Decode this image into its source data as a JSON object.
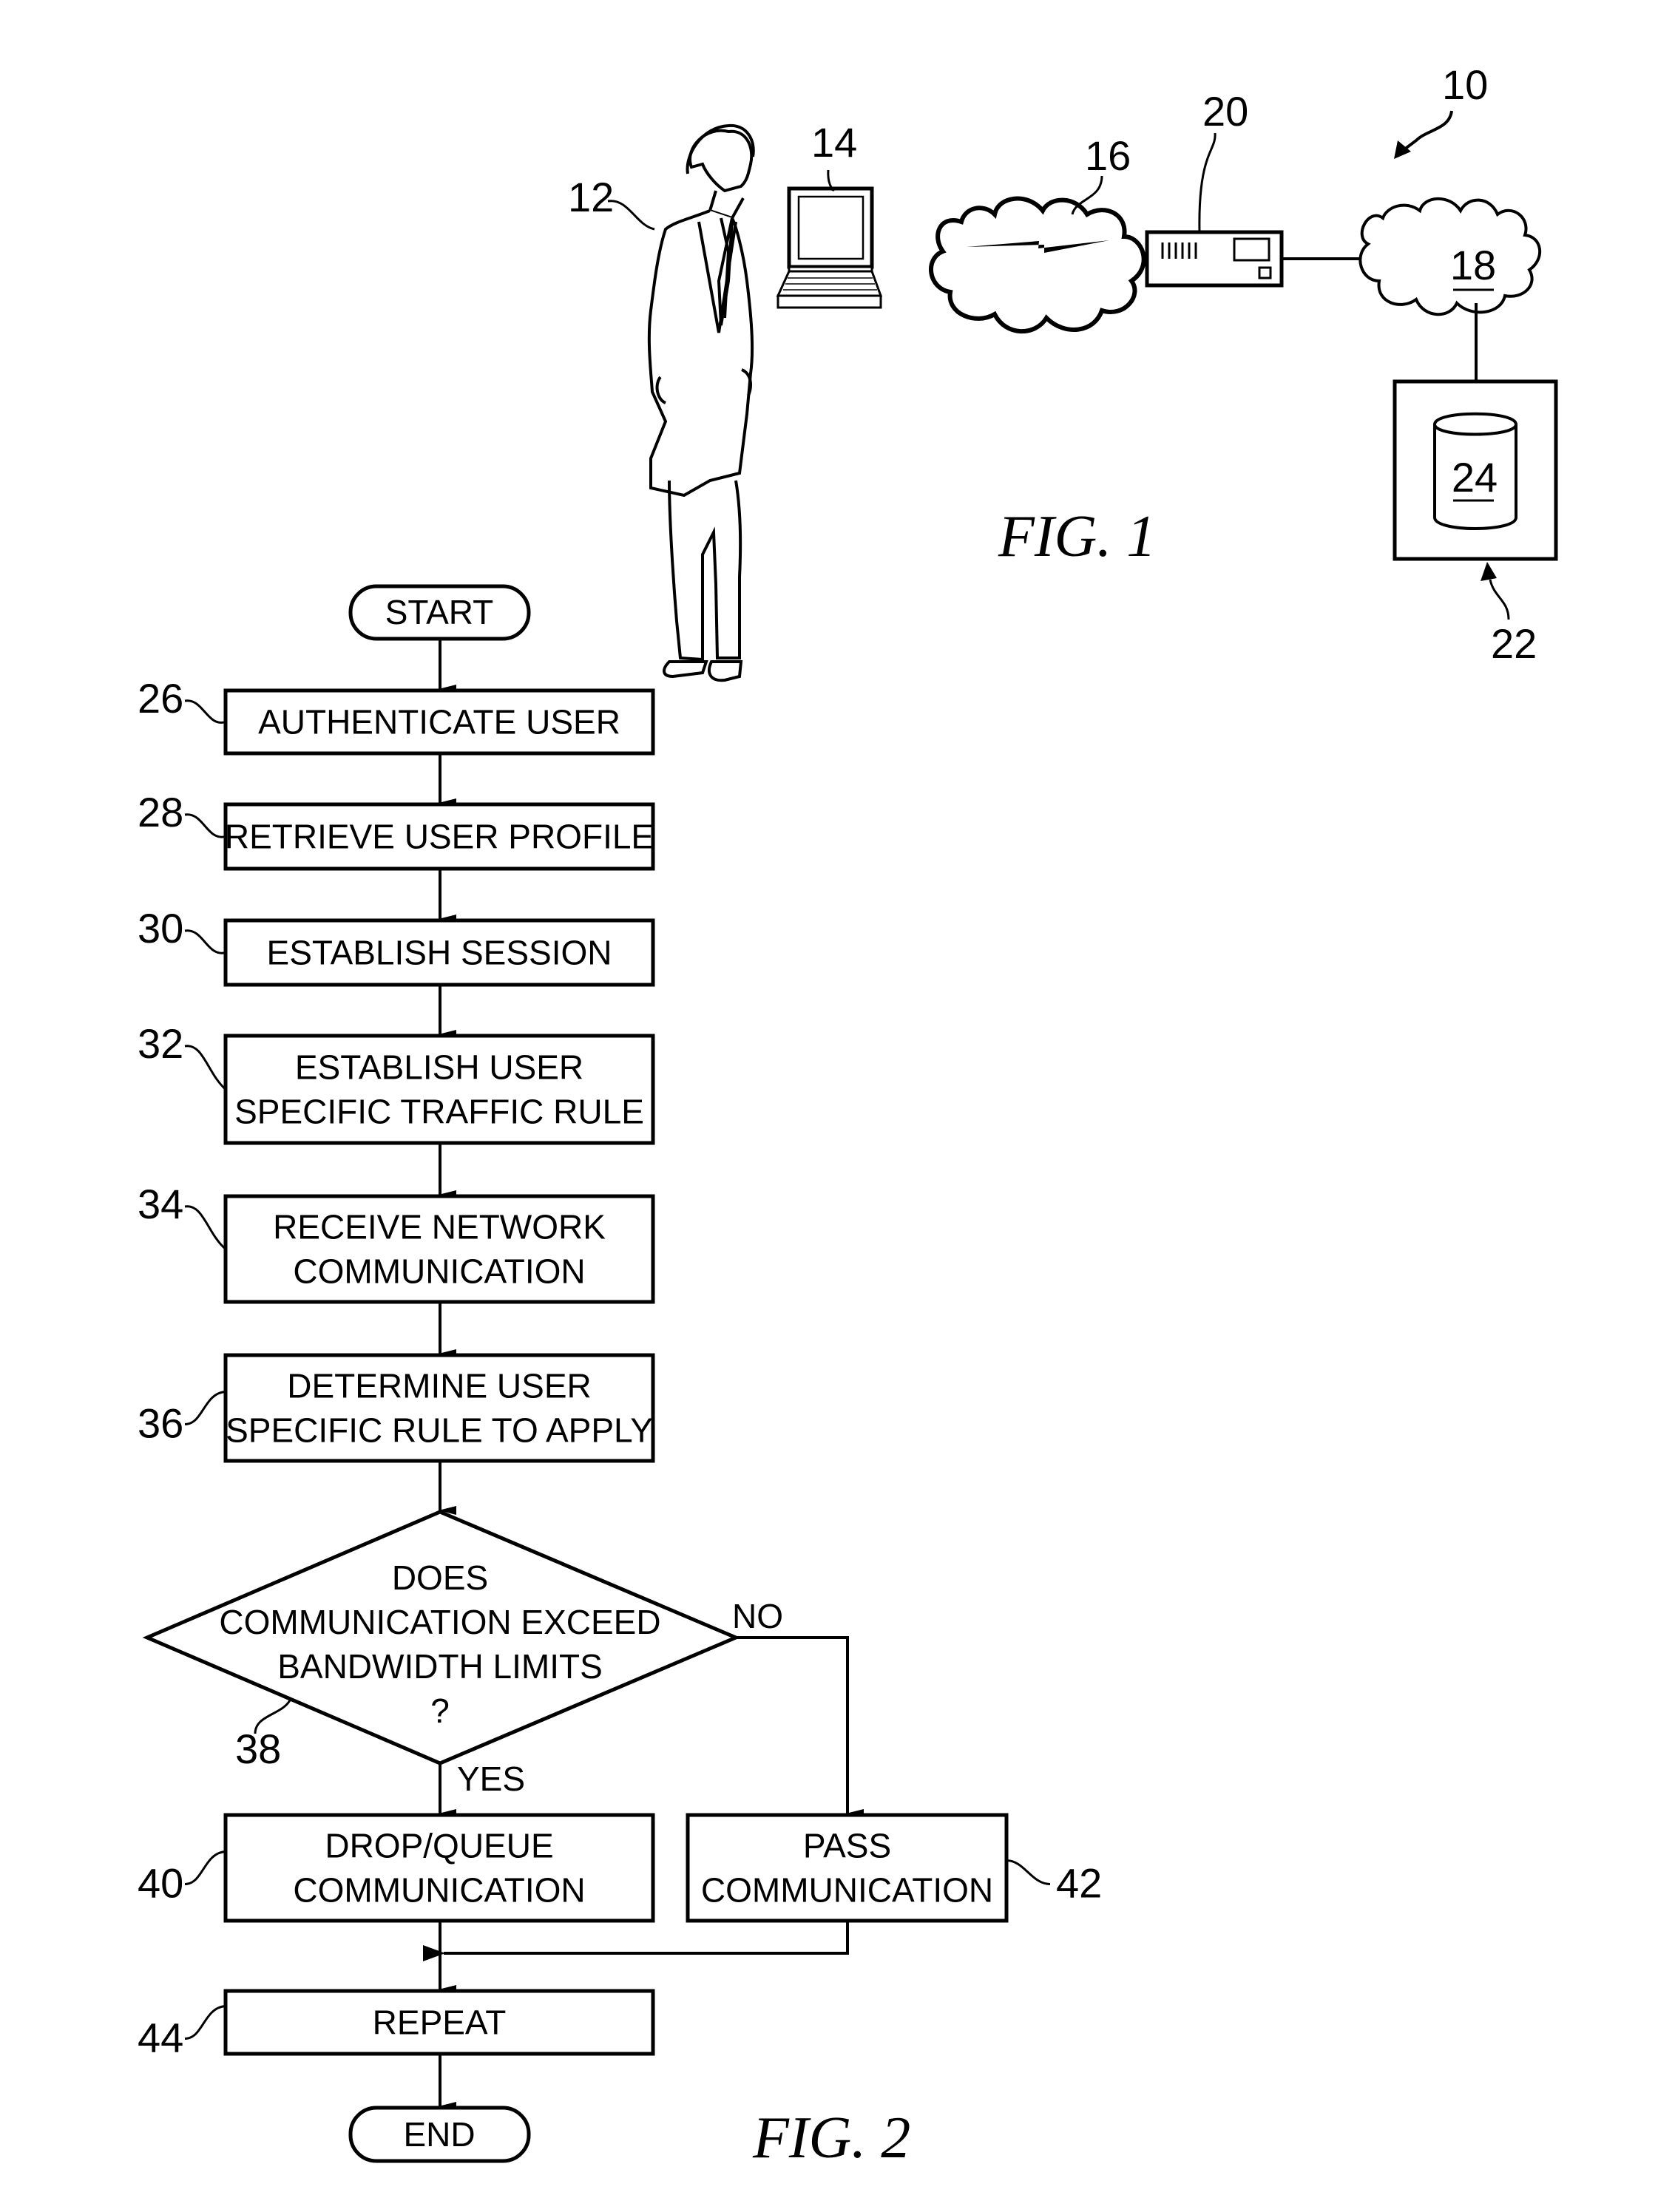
{
  "figure1": {
    "caption": "FIG. 1",
    "refs": {
      "system": "10",
      "user": "12",
      "computer": "14",
      "network": "16",
      "network2": "18",
      "server": "20",
      "storage": "22",
      "database": "24"
    },
    "icons": [
      "person-icon",
      "laptop-icon",
      "wireless-cloud-icon",
      "server-icon",
      "network-cloud-icon",
      "database-icon"
    ]
  },
  "figure2": {
    "caption": "FIG. 2",
    "start": "START",
    "end": "END",
    "steps": [
      {
        "ref": "26",
        "lines": [
          "AUTHENTICATE USER"
        ]
      },
      {
        "ref": "28",
        "lines": [
          "RETRIEVE USER PROFILE"
        ]
      },
      {
        "ref": "30",
        "lines": [
          "ESTABLISH SESSION"
        ]
      },
      {
        "ref": "32",
        "lines": [
          "ESTABLISH USER",
          "SPECIFIC TRAFFIC RULE"
        ]
      },
      {
        "ref": "34",
        "lines": [
          "RECEIVE NETWORK",
          "COMMUNICATION"
        ]
      },
      {
        "ref": "36",
        "lines": [
          "DETERMINE USER",
          "SPECIFIC RULE TO APPLY"
        ]
      }
    ],
    "decision": {
      "ref": "38",
      "lines": [
        "DOES",
        "COMMUNICATION EXCEED",
        "BANDWIDTH LIMITS",
        "?"
      ],
      "yes_label": "YES",
      "no_label": "NO"
    },
    "yes_step": {
      "ref": "40",
      "lines": [
        "DROP/QUEUE",
        "COMMUNICATION"
      ]
    },
    "no_step": {
      "ref": "42",
      "lines": [
        "PASS",
        "COMMUNICATION"
      ]
    },
    "repeat_step": {
      "ref": "44",
      "lines": [
        "REPEAT"
      ]
    }
  }
}
